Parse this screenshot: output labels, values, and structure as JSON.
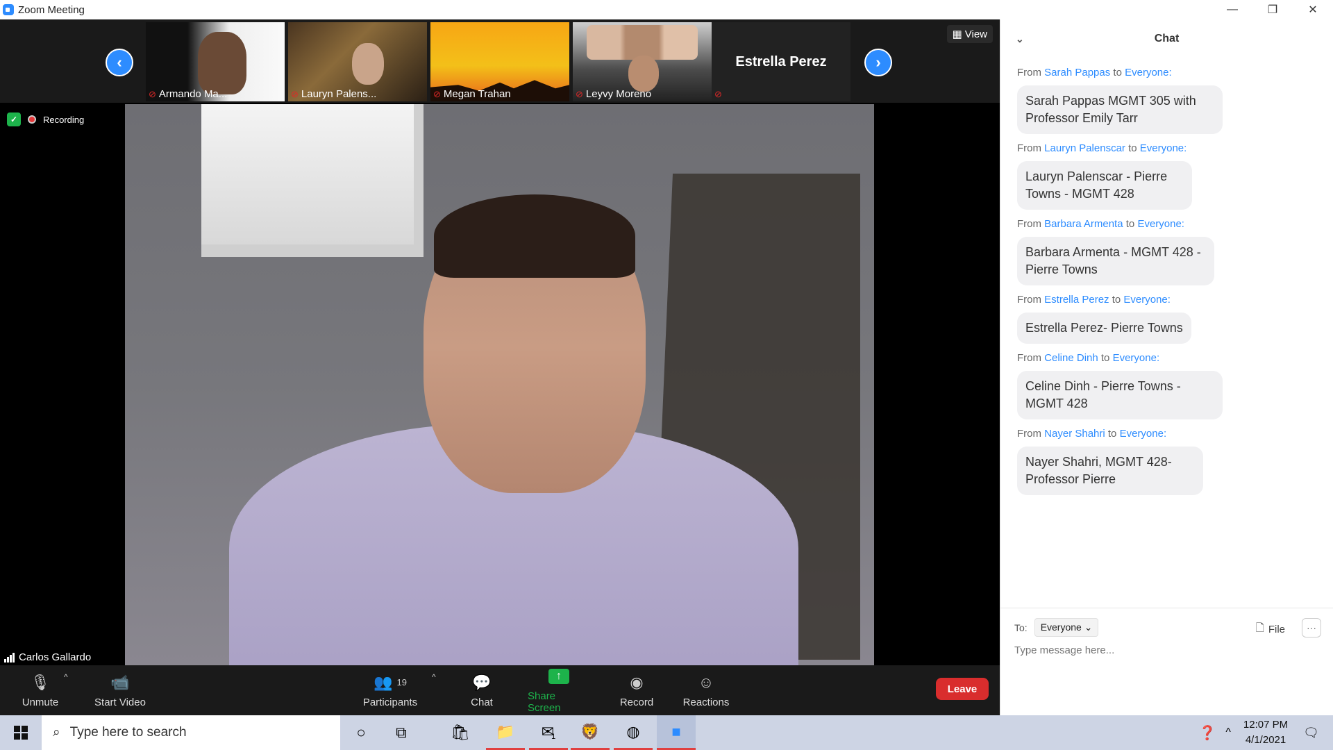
{
  "window": {
    "title": "Zoom Meeting",
    "controls": [
      "—",
      "❐",
      "✕"
    ]
  },
  "thumbnails": [
    {
      "name": "Armando Ma...",
      "muted": true
    },
    {
      "name": "Lauryn Palens...",
      "muted": true
    },
    {
      "name": "Megan Trahan",
      "muted": true
    },
    {
      "name": "Leyvy Moreno",
      "muted": true
    },
    {
      "name": "Estrella Perez",
      "muted": true
    }
  ],
  "view_label": "View",
  "recording_label": "Recording",
  "speaker_name": "Carlos Gallardo",
  "toolbar": {
    "unmute": "Unmute",
    "start_video": "Start Video",
    "participants": "Participants",
    "participants_count": "19",
    "chat": "Chat",
    "share_screen": "Share Screen",
    "record": "Record",
    "reactions": "Reactions",
    "leave": "Leave"
  },
  "chat": {
    "title": "Chat",
    "messages": [
      {
        "from": "Sarah Pappas",
        "to": "Everyone:",
        "text": "Sarah Pappas MGMT 305 with Professor Emily Tarr"
      },
      {
        "from": "Lauryn Palenscar",
        "to": "Everyone:",
        "text": "Lauryn Palenscar - Pierre Towns - MGMT 428"
      },
      {
        "from": "Barbara Armenta",
        "to": "Everyone:",
        "text": "Barbara Armenta - MGMT 428 - Pierre Towns"
      },
      {
        "from": "Estrella Perez",
        "to": "Everyone:",
        "text": "Estrella Perez- Pierre Towns"
      },
      {
        "from": "Celine Dinh",
        "to": "Everyone:",
        "text": "Celine Dinh - Pierre Towns - MGMT 428"
      },
      {
        "from": "Nayer Shahri",
        "to": "Everyone:",
        "text": "Nayer Shahri, MGMT 428- Professor Pierre"
      }
    ],
    "from_word": "From",
    "to_word": "to",
    "to_label": "To:",
    "recipient": "Everyone",
    "file_label": "File",
    "input_placeholder": "Type message here..."
  },
  "taskbar": {
    "search_placeholder": "Type here to search",
    "time": "12:07 PM",
    "date": "4/1/2021",
    "mail_badge": "1"
  },
  "colors": {
    "zoom_blue": "#2d8cff",
    "leave_red": "#d92d2d",
    "share_green": "#1db34b"
  }
}
